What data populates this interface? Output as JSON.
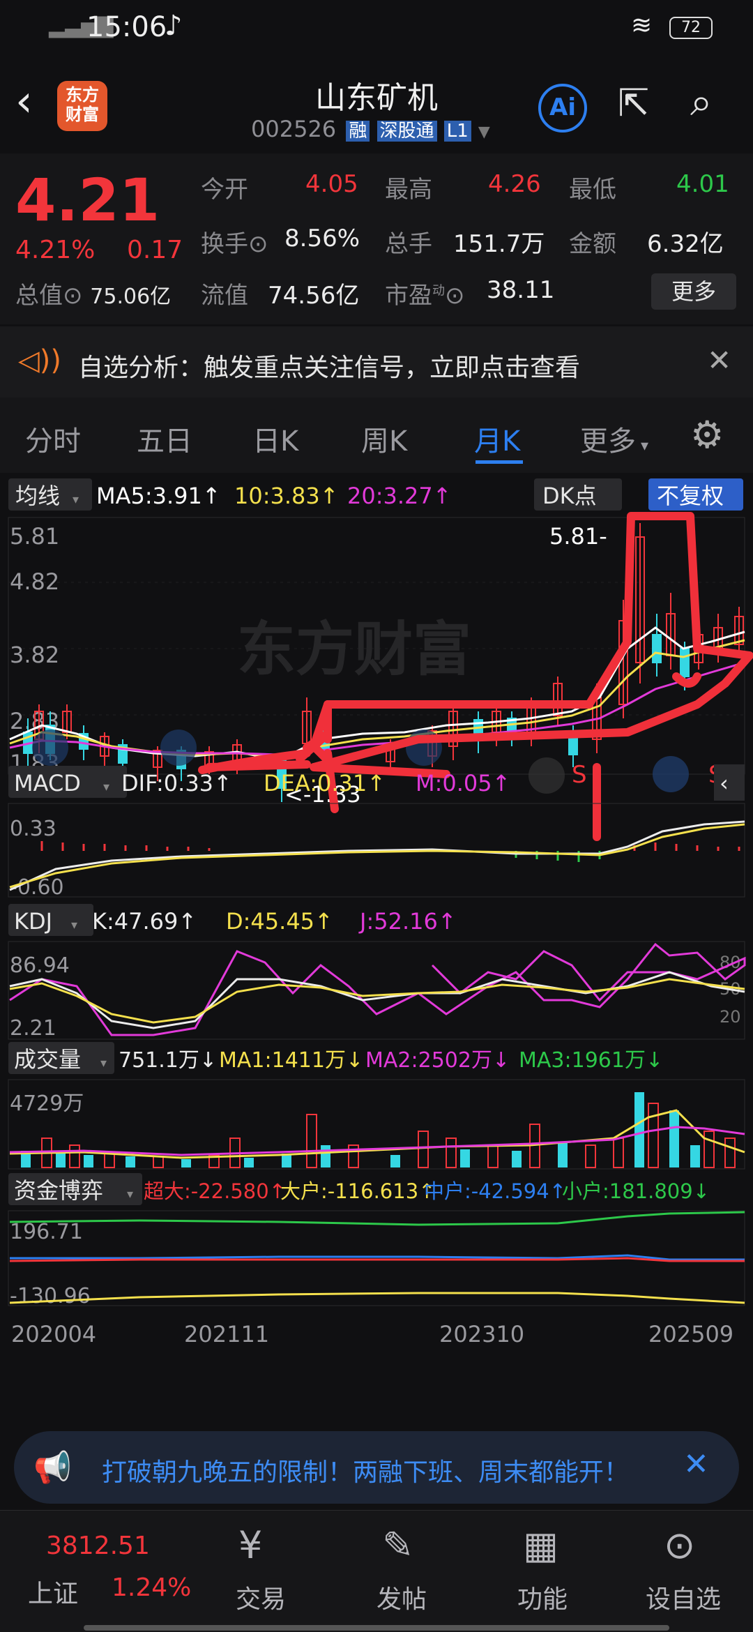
{
  "status": {
    "time": "15:06",
    "battery": "72"
  },
  "header": {
    "title": "山东矿机",
    "code": "002526",
    "badges": [
      "融",
      "深股通",
      "L1"
    ],
    "logo_line1": "东方",
    "logo_line2": "财富",
    "ai_label": "Ai"
  },
  "quote": {
    "price": "4.21",
    "change_pct": "4.21%",
    "change": "0.17",
    "open_label": "今开",
    "open": "4.05",
    "high_label": "最高",
    "high": "4.26",
    "low_label": "最低",
    "low": "4.01",
    "turnover_label": "换手",
    "turnover": "8.56%",
    "volume_label": "总手",
    "volume": "151.7万",
    "amount_label": "金额",
    "amount": "6.32亿",
    "mktcap_label": "总值",
    "mktcap": "75.06亿",
    "float_label": "流值",
    "float": "74.56亿",
    "pe_label": "市盈",
    "pe_sup": "动",
    "pe": "38.11",
    "more": "更多"
  },
  "notice": {
    "text": "自选分析：触发重点关注信号，立即点击查看"
  },
  "tabs": [
    "分时",
    "五日",
    "日K",
    "周K",
    "月K",
    "更多"
  ],
  "active_tab": 4,
  "kline": {
    "ma_label": "均线",
    "ma5": "MA5:3.91↑",
    "ma10": "10:3.83↑",
    "ma20": "20:3.27↑",
    "dk": "DK点",
    "adjust": "不复权",
    "y_ticks": [
      "5.81",
      "4.82",
      "3.82",
      "2.83",
      "1.83"
    ],
    "high_mark": "5.81-",
    "low_mark": "<-1.83",
    "watermark": "东方财富",
    "s1": "S",
    "s2": "S"
  },
  "macd": {
    "label": "MACD",
    "dif": "DIF:0.33↑",
    "dea": "DEA:0.31↑",
    "m": "M:0.05↑",
    "top": "0.33",
    "bottom": "-0.60"
  },
  "kdj": {
    "label": "KDJ",
    "k": "K:47.69↑",
    "d": "D:45.45↑",
    "j": "J:52.16↑",
    "top": "86.94",
    "bottom": "2.21",
    "r80": "80",
    "r50": "50",
    "r20": "20"
  },
  "vol": {
    "label": "成交量",
    "v": "751.1万↓",
    "ma1": "MA1:1411万↓",
    "ma2": "MA2:2502万↓",
    "ma3": "MA3:1961万↓",
    "top": "4729万"
  },
  "fund": {
    "label": "资金博弈",
    "super": "超大:-22.580↑",
    "big": "大户:-116.613↑",
    "mid": "中户:-42.594↑",
    "small": "小户:181.809↓",
    "top": "196.71",
    "bottom": "-130.96"
  },
  "x_axis": [
    "202004",
    "202111",
    "202310",
    "202509"
  ],
  "banner": {
    "text": "打破朝九晚五的限制！两融下班、周末都能开！"
  },
  "nav": {
    "index_value": "3812.51",
    "index_name": "上证",
    "index_change": "1.24%",
    "items": [
      "交易",
      "发帖",
      "功能",
      "设自选"
    ]
  },
  "colors": {
    "up": "#f2353b",
    "down": "#35d7e3",
    "ma5": "#ffffff",
    "ma10": "#f4e04d",
    "ma20": "#e23ad9",
    "accent": "#2d7ff0",
    "annotation": "#f0303a"
  }
}
